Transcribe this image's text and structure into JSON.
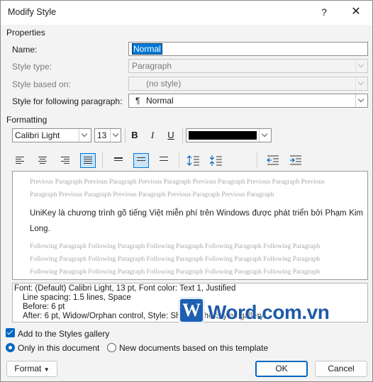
{
  "window": {
    "title": "Modify Style",
    "help": "?",
    "close": "✕"
  },
  "properties": {
    "heading": "Properties",
    "name_label": "Name:",
    "name_value": "Normal",
    "style_type_label": "Style type:",
    "style_type_value": "Paragraph",
    "based_on_label": "Style based on:",
    "based_on_value": "(no style)",
    "following_label": "Style for following paragraph:",
    "following_icon": "¶",
    "following_value": "Normal"
  },
  "formatting": {
    "heading": "Formatting",
    "font": "Calibri Light",
    "size": "13",
    "bold": "B",
    "italic": "I",
    "underline": "U",
    "font_color": "#000000"
  },
  "preview": {
    "prev1": "Previous Paragraph Previous Paragraph Previous Paragraph Previous Paragraph Previous Paragraph Previous",
    "prev2": "Paragraph Previous Paragraph Previous Paragraph Previous Paragraph Previous Paragraph",
    "sample": "UniKey là chương trình gõ tiếng Việt miễn phí trên Windows được phát triển bởi Phạm Kim Long.",
    "follow1": "Following Paragraph Following Paragraph Following Paragraph Following Paragraph Following Paragraph",
    "follow2": "Following Paragraph Following Paragraph Following Paragraph Following Paragraph Following Paragraph",
    "follow3": "Following Paragraph Following Paragraph Following Paragraph Following Paragraph Following Paragraph"
  },
  "description": {
    "line1": "Font: (Default) Calibri Light, 13 pt, Font color: Text 1, Justified",
    "line2": "Line spacing:  1.5 lines, Space",
    "line3": "Before:  6 pt",
    "line4": "After:  6 pt, Widow/Orphan control, Style: Show in the Styles gallery"
  },
  "watermark": {
    "logo": "W",
    "text": "Word.com.vn"
  },
  "options": {
    "add_gallery": "Add to the Styles gallery",
    "only_doc": "Only in this document",
    "new_docs": "New documents based on this template"
  },
  "buttons": {
    "format": "Format",
    "ok": "OK",
    "cancel": "Cancel"
  },
  "colors": {
    "accent": "#0067c0",
    "selection": "#0078d7",
    "watermark": "#1e5aa8"
  }
}
